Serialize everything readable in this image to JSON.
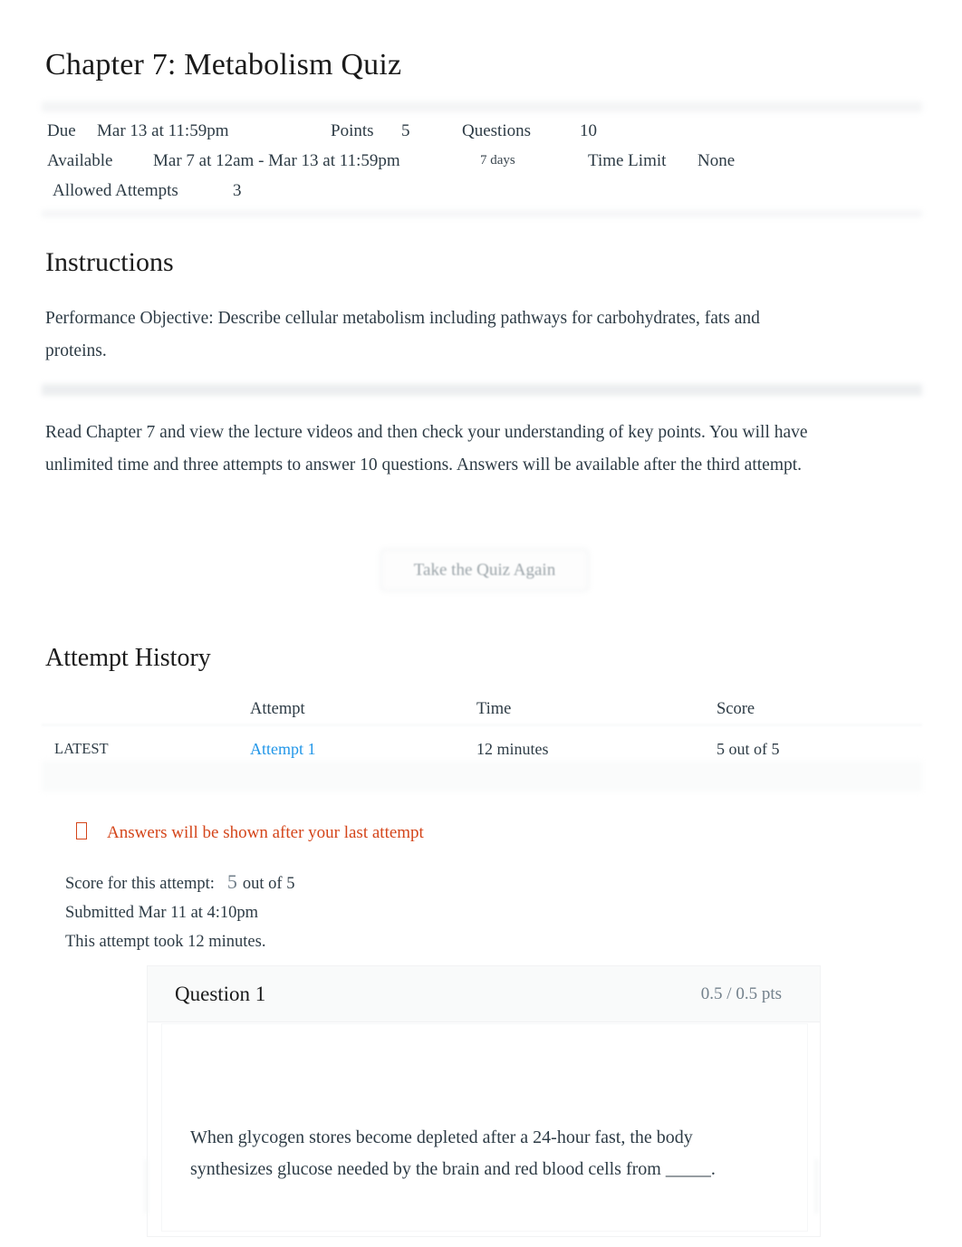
{
  "quiz": {
    "title": "Chapter 7: Metabolism Quiz",
    "meta": {
      "due_label": "Due",
      "due_value": "Mar 13 at 11:59pm",
      "points_label": "Points",
      "points_value": "5",
      "questions_label": "Questions",
      "questions_value": "10",
      "available_label": "Available",
      "available_value": "Mar 7 at 12am - Mar 13 at 11:59pm",
      "duration_value": "7 days",
      "time_limit_label": "Time Limit",
      "time_limit_value": "None",
      "allowed_attempts_label": "Allowed Attempts",
      "allowed_attempts_value": "3"
    }
  },
  "instructions": {
    "heading": "Instructions",
    "objective": "Performance Objective: Describe cellular metabolism including pathways for carbohydrates, fats and proteins.",
    "body": "Read Chapter 7 and view the lecture videos and then check your understanding of key points. You will have unlimited time and three attempts to answer 10 questions. Answers will be available after the third attempt."
  },
  "retake": {
    "label": "Take the Quiz Again"
  },
  "attempt_history": {
    "heading": "Attempt History",
    "columns": {
      "kept": "",
      "attempt": "Attempt",
      "time": "Time",
      "score": "Score"
    },
    "rows": [
      {
        "kept": "LATEST",
        "attempt": "Attempt 1",
        "time": "12 minutes",
        "score": "5 out of 5"
      }
    ]
  },
  "alert": {
    "icon": "warning-outline-icon",
    "text": "Answers will be shown after your last attempt",
    "color": "#d4451a"
  },
  "score_summary": {
    "score_label": "Score for this attempt:",
    "score_value": "5",
    "score_suffix": "out of 5",
    "submitted": "Submitted Mar 11 at 4:10pm",
    "duration": "This attempt took 12 minutes."
  },
  "question": {
    "title": "Question 1",
    "points": "0.5 / 0.5 pts",
    "text": "When glycogen stores become depleted after a 24-hour fast, the body synthesizes glucose needed by the brain and red blood cells from _____."
  },
  "colors": {
    "link": "#2196e8",
    "alert": "#d4451a",
    "muted": "#73818c",
    "text": "#2d3b45"
  }
}
